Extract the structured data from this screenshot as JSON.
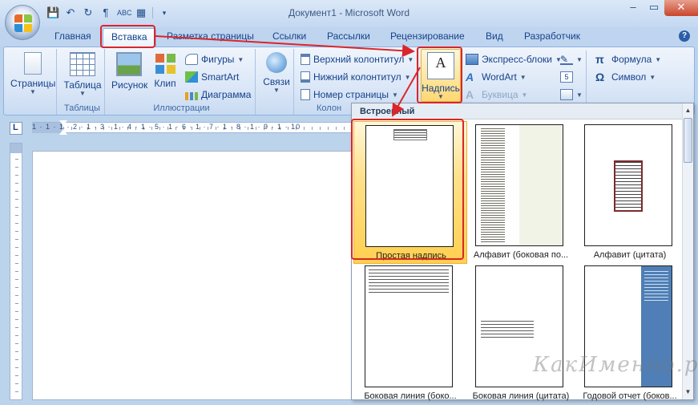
{
  "window": {
    "title": "Документ1 - Microsoft Word",
    "minimize": "–",
    "restore": "▭",
    "close": "✕"
  },
  "quick_access": [
    "save-icon",
    "undo-icon",
    "redo-icon",
    "paragraph-icon",
    "spelling-icon",
    "layout-icon",
    "customize-icon"
  ],
  "tabs": [
    {
      "label": "Главная"
    },
    {
      "label": "Вставка"
    },
    {
      "label": "Разметка страницы"
    },
    {
      "label": "Ссылки"
    },
    {
      "label": "Рассылки"
    },
    {
      "label": "Рецензирование"
    },
    {
      "label": "Вид"
    },
    {
      "label": "Разработчик"
    }
  ],
  "ribbon": {
    "groups": {
      "tables_label": "Таблицы",
      "illustrations_label": "Иллюстрации",
      "header_footer_label": "Колон"
    },
    "pages": "Страницы",
    "table": "Таблица",
    "picture": "Рисунок",
    "clip": "Клип",
    "shapes": "Фигуры",
    "smartart": "SmartArt",
    "chart": "Диаграмма",
    "links": "Связи",
    "header": "Верхний колонтитул",
    "footer": "Нижний колонтитул",
    "page_number": "Номер страницы",
    "textbox": "Надпись",
    "quick_parts": "Экспресс-блоки",
    "wordart": "WordArt",
    "dropcap": "Буквица",
    "equation": "Формула",
    "symbol": "Символ"
  },
  "ruler": {
    "numbers": "1 · 1 · 1 · 2 · 1 · 3 · 1 · 4 · 1 · 5 · 1 · 6 · 1 · 7 · 1 · 8 · 1 · 9 · 1 · 10"
  },
  "gallery": {
    "header": "Встроенный",
    "items": [
      {
        "caption": "Простая надпись",
        "selected": true
      },
      {
        "caption": "Алфавит (боковая по..."
      },
      {
        "caption": "Алфавит (цитата)"
      },
      {
        "caption": "Боковая линия (боко..."
      },
      {
        "caption": "Боковая линия (цитата)"
      },
      {
        "caption": "Годовой отчет (боков..."
      }
    ]
  },
  "watermark": "КакИменно.ру",
  "colors": {
    "accent_red": "#d9262b",
    "ribbon_blue": "#15428b",
    "selected_gold": "#ffd050"
  }
}
